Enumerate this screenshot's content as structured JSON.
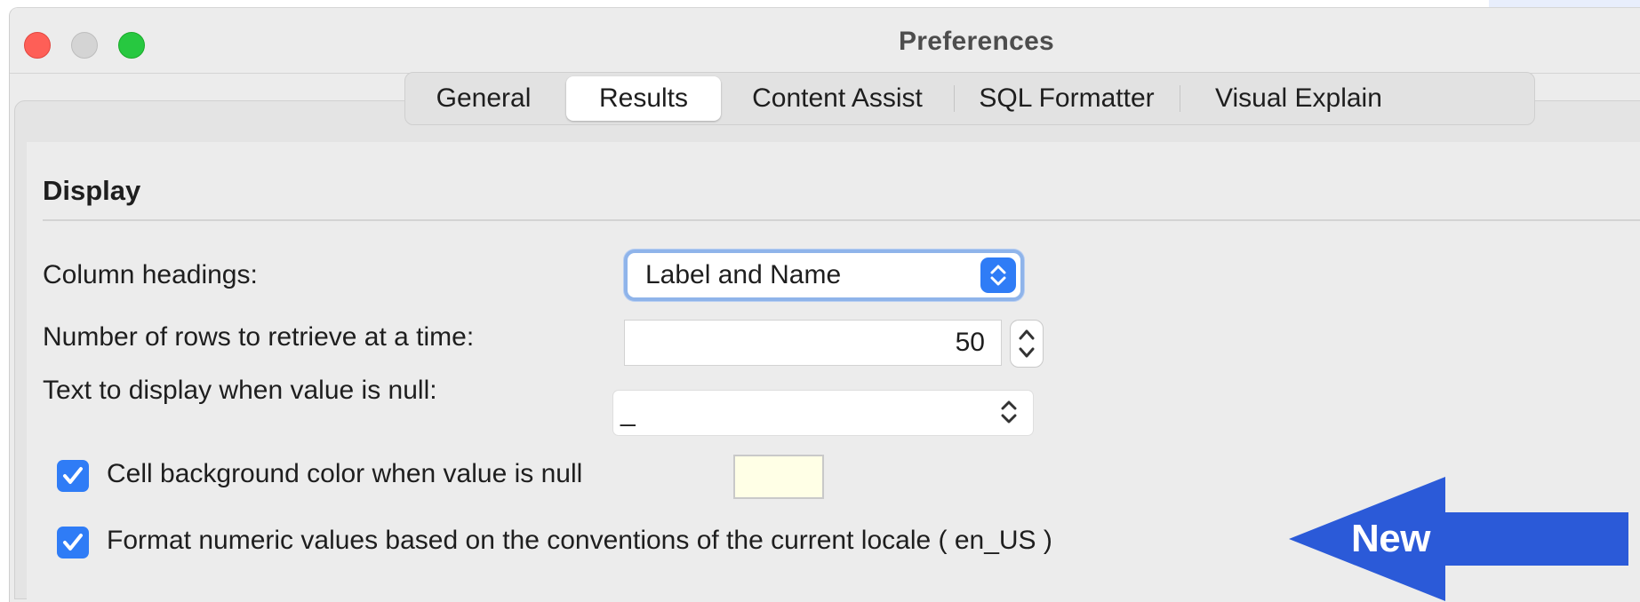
{
  "window": {
    "title": "Preferences"
  },
  "tabs": [
    {
      "label": "General"
    },
    {
      "label": "Results"
    },
    {
      "label": "Content Assist"
    },
    {
      "label": "SQL Formatter"
    },
    {
      "label": "Visual Explain"
    }
  ],
  "active_tab": "Results",
  "display": {
    "section_title": "Display",
    "column_headings_label": "Column headings:",
    "column_headings_value": "Label and Name",
    "rows_label": "Number of rows to retrieve at a time:",
    "rows_value": "50",
    "null_text_label": "Text to display when value is null:",
    "null_text_value": "_",
    "cell_bg_label": "Cell background color when value is null",
    "cell_bg_checked": true,
    "cell_bg_color": "#ffffe6",
    "format_numeric_label": "Format numeric values based on the conventions of the current locale ( en_US )",
    "format_numeric_checked": true
  },
  "annotation": {
    "label": "New",
    "color": "#2b5ad8"
  },
  "colors": {
    "accent": "#2f7cf6",
    "window_bg": "#ececec"
  },
  "icons": [
    "close-button",
    "minimize-button",
    "zoom-button",
    "chevron-updown-icon",
    "stepper-up-icon",
    "stepper-down-icon",
    "checkmark-icon",
    "arrow-left-icon"
  ]
}
